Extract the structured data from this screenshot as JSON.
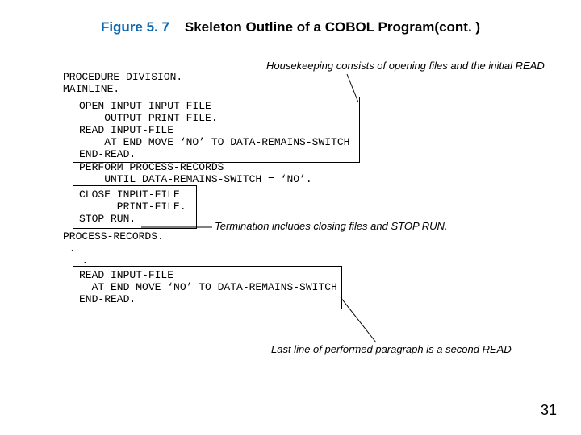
{
  "title": {
    "figure": "Figure 5. 7",
    "text": "Skeleton Outline of a COBOL Program(cont. )"
  },
  "annotations": {
    "housekeeping": "Housekeeping consists of opening files and the initial READ",
    "termination": "Termination includes closing files and STOP RUN.",
    "lastline": "Last line of performed paragraph is a second READ"
  },
  "code": {
    "proc1": "PROCEDURE DIVISION.",
    "proc2": "MAINLINE.",
    "box1_l1": "OPEN INPUT INPUT-FILE",
    "box1_l2": "    OUTPUT PRINT-FILE.",
    "box1_l3": "READ INPUT-FILE",
    "box1_l4": "    AT END MOVE ‘NO’ TO DATA-REMAINS-SWITCH",
    "box1_l5": "END-READ.",
    "mid_l1": "PERFORM PROCESS-RECORDS",
    "mid_l2": "    UNTIL DATA-REMAINS-SWITCH = ‘NO’.",
    "box2_l1": "CLOSE INPUT-FILE",
    "box2_l2": "      PRINT-FILE.",
    "box2_l3": "STOP RUN.",
    "after_l1": "PROCESS-RECORDS.",
    "after_l2": " .",
    "after_l3": "   .",
    "box3_l1": "READ INPUT-FILE",
    "box3_l2": "  AT END MOVE ‘NO’ TO DATA-REMAINS-SWITCH",
    "box3_l3": "END-READ."
  },
  "page": "31"
}
